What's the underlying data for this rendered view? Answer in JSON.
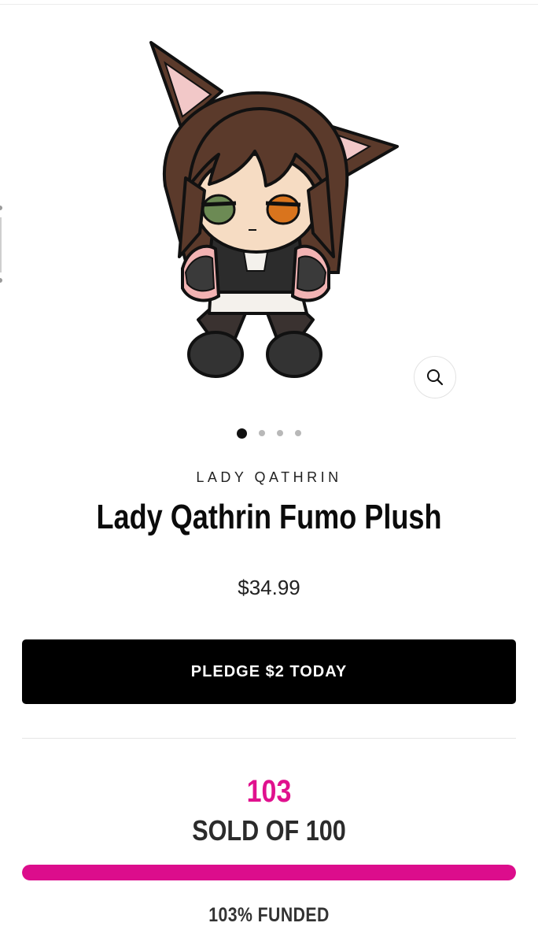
{
  "product": {
    "vendor": "LADY QATHRIN",
    "title": "Lady Qathrin Fumo Plush",
    "price": "$34.99",
    "image_icon": "chibi-plush-image"
  },
  "gallery": {
    "slide_count": 4,
    "active_slide": 1,
    "zoom_icon": "magnifier-icon"
  },
  "actions": {
    "pledge_label": "PLEDGE $2 TODAY"
  },
  "funding": {
    "sold": "103",
    "sold_of_label": "SOLD OF 100",
    "funded_label": "103% FUNDED",
    "progress_fraction": 1.0
  },
  "colors": {
    "accent": "#dc0d8c",
    "button": "#000000"
  }
}
